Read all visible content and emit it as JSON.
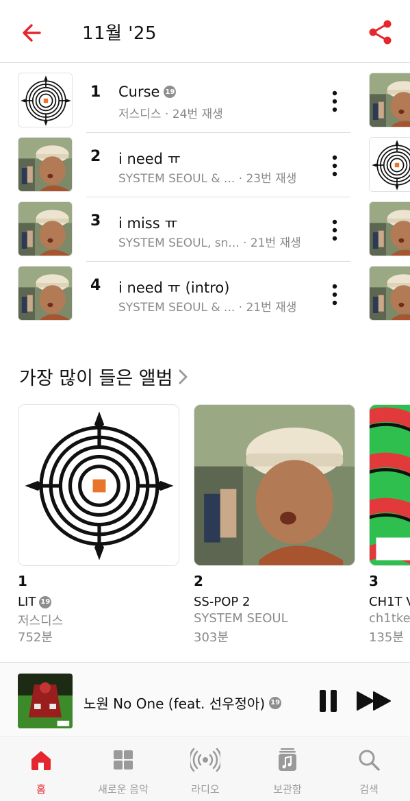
{
  "header": {
    "title": "11월 '25"
  },
  "tracks": [
    {
      "rank": "1",
      "title": "Curse",
      "explicit": true,
      "artist": "저스디스",
      "plays": "· 24번 재생",
      "art": "maze"
    },
    {
      "rank": "2",
      "title": "i need ㅠ",
      "explicit": false,
      "artist": "SYSTEM SEOUL & ...",
      "plays": "· 23번 재생",
      "art": "man"
    },
    {
      "rank": "3",
      "title": "i miss ㅠ",
      "explicit": false,
      "artist": "SYSTEM SEOUL, sn...",
      "plays": "· 21번 재생",
      "art": "man"
    },
    {
      "rank": "4",
      "title": "i need ㅠ (intro)",
      "explicit": false,
      "artist": "SYSTEM SEOUL & ...",
      "plays": "· 21번 재생",
      "art": "man"
    }
  ],
  "explicit_badge": "19",
  "albums_section": {
    "title": "가장 많이 들은 앨범",
    "albums": [
      {
        "rank": "1",
        "name": "LIT",
        "explicit": true,
        "artist": "저스디스",
        "minutes": "752분"
      },
      {
        "rank": "2",
        "name": "SS-POP 2",
        "explicit": false,
        "artist": "SYSTEM SEOUL",
        "minutes": "303분"
      },
      {
        "rank": "3",
        "name": "CH1T V",
        "explicit": false,
        "artist": "ch1tke",
        "minutes": "135분"
      }
    ]
  },
  "now_playing": {
    "title": "노원 No One (feat. 선우정아)",
    "explicit": true
  },
  "tabs": [
    {
      "label": "홈",
      "icon": "home-icon",
      "active": true
    },
    {
      "label": "새로운 음악",
      "icon": "grid-icon",
      "active": false
    },
    {
      "label": "라디오",
      "icon": "radio-icon",
      "active": false
    },
    {
      "label": "보관함",
      "icon": "library-icon",
      "active": false
    },
    {
      "label": "검색",
      "icon": "search-icon",
      "active": false
    }
  ],
  "colors": {
    "accent": "#e5262f",
    "secondary_text": "#8a8a8a"
  }
}
